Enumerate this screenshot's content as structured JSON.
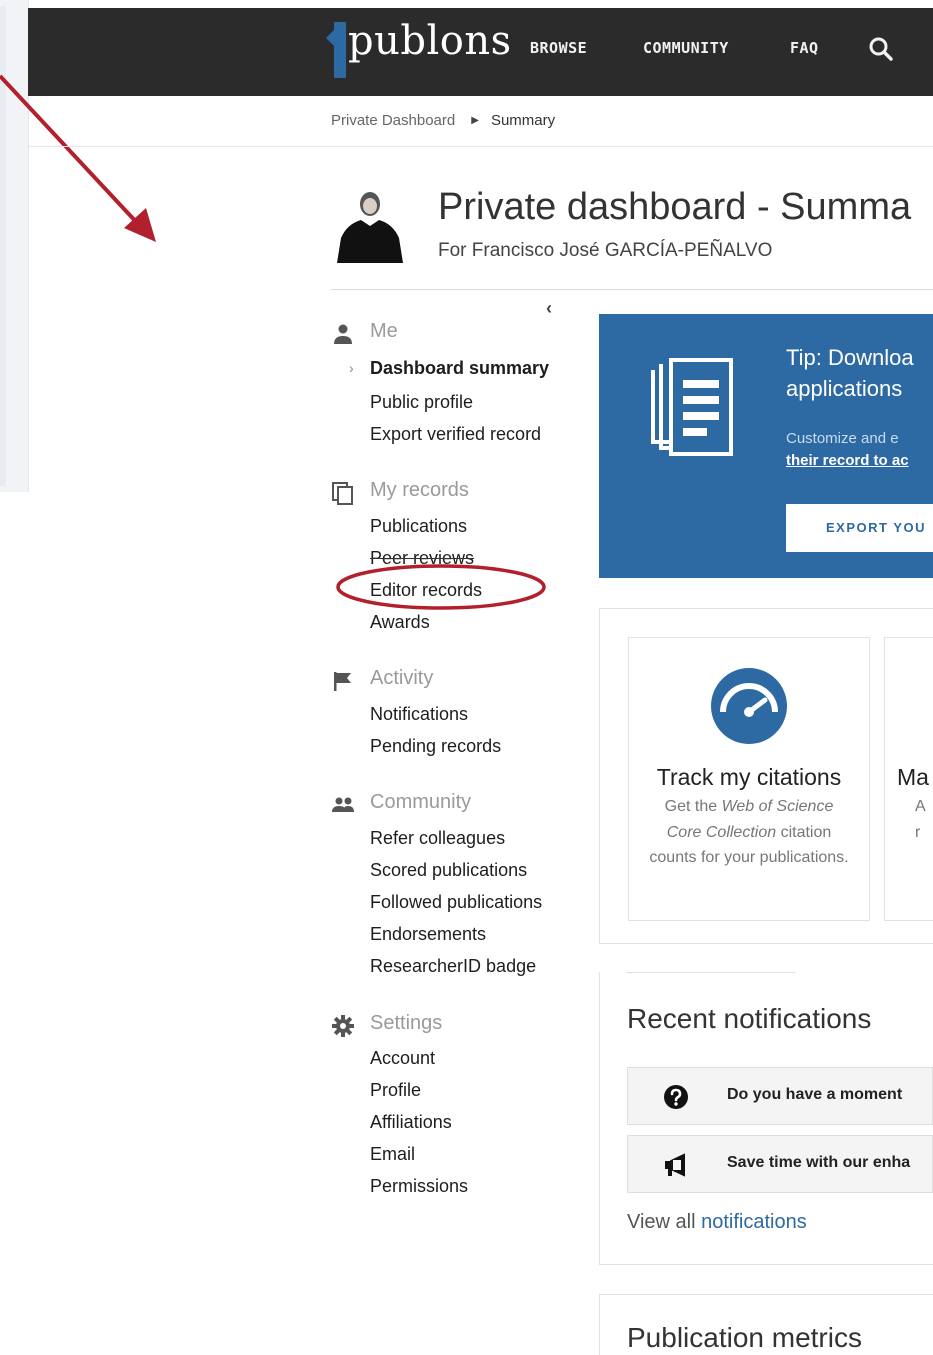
{
  "nav": {
    "logo": "publons",
    "browse": "BROWSE",
    "community": "COMMUNITY",
    "faq": "FAQ"
  },
  "breadcrumb": {
    "root": "Private Dashboard",
    "current": "Summary"
  },
  "header": {
    "title": "Private dashboard - Summa",
    "subtitle": "For Francisco José GARCÍA-PEÑALVO"
  },
  "sidebar": {
    "collapse": "‹",
    "sections": [
      {
        "label": "Me",
        "icon": "person-icon",
        "items": [
          "Dashboard summary",
          "Public profile",
          "Export verified record"
        ]
      },
      {
        "label": "My records",
        "icon": "copy-icon",
        "items": [
          "Publications",
          "Peer reviews",
          "Editor records",
          "Awards"
        ]
      },
      {
        "label": "Activity",
        "icon": "flag-icon",
        "items": [
          "Notifications",
          "Pending records"
        ]
      },
      {
        "label": "Community",
        "icon": "people-icon",
        "items": [
          "Refer colleagues",
          "Scored publications",
          "Followed publications",
          "Endorsements",
          "ResearcherID badge"
        ]
      },
      {
        "label": "Settings",
        "icon": "gear-icon",
        "items": [
          "Account",
          "Profile",
          "Affiliations",
          "Email",
          "Permissions"
        ]
      }
    ]
  },
  "tip": {
    "title_line1": "Tip: Downloa",
    "title_line2": "applications",
    "body": "Customize and e",
    "link": "their record to ac",
    "button": "EXPORT YOU"
  },
  "cards": {
    "card1_title": "Track my citations",
    "card1_desc_a": "Get the ",
    "card1_desc_em1": "Web of Science",
    "card1_desc_em2": "Core Collection",
    "card1_desc_b": " citation counts for your publications.",
    "card2_title": "Ma",
    "card2_line1": "A",
    "card2_line2": "r"
  },
  "notifications": {
    "heading": "Recent notifications",
    "items": [
      {
        "icon": "question-circle-icon",
        "text": "Do you have a moment"
      },
      {
        "icon": "megaphone-icon",
        "text": "Save time with our enha"
      }
    ],
    "view_all_prefix": "View all ",
    "view_all_link": "notifications"
  },
  "metrics": {
    "heading": "Publication metrics"
  },
  "colors": {
    "topbar": "#2b2b2b",
    "brand_blue": "#2d6aa3",
    "annotation_red": "#b3202d"
  }
}
